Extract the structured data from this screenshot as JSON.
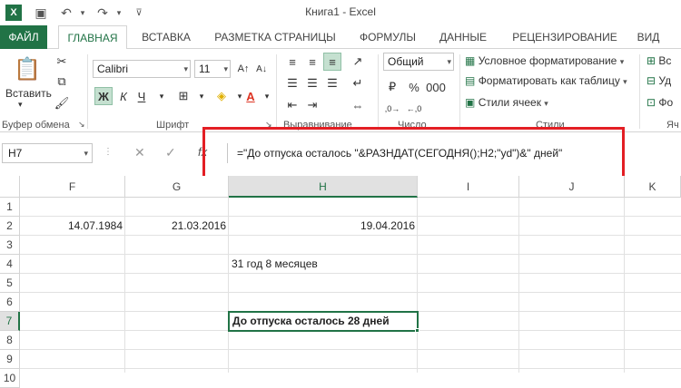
{
  "window": {
    "title": "Книга1 - Excel"
  },
  "quick_access": [
    "excel-logo-icon",
    "save-icon",
    "undo-icon",
    "redo-icon",
    "customize-icon"
  ],
  "tabs": [
    "ФАЙЛ",
    "ГЛАВНАЯ",
    "ВСТАВКА",
    "РАЗМЕТКА СТРАНИЦЫ",
    "ФОРМУЛЫ",
    "ДАННЫЕ",
    "РЕЦЕНЗИРОВАНИЕ",
    "ВИД"
  ],
  "ribbon": {
    "paste_label": "Вставить",
    "clipboard_label": "Буфер обмена",
    "font_label": "Шрифт",
    "font_name": "Calibri",
    "font_size": "11",
    "bold": "Ж",
    "italic": "К",
    "underline": "Ч",
    "alignment_label": "Выравнивание",
    "number_label": "Число",
    "number_format": "Общий",
    "styles_label": "Стили",
    "conditional_format": "Условное форматирование",
    "format_table": "Форматировать как таблицу",
    "cell_styles": "Стили ячеек",
    "cells_label": "Яч",
    "insert_partial": "Вс",
    "delete_partial": "Уд",
    "format_partial": "Фо"
  },
  "formula_bar": {
    "name_box": "H7",
    "formula": "=\"До отпуска осталось \"&РАЗНДАТ(СЕГОДНЯ();H2;\"yd\")&\" дней\""
  },
  "grid": {
    "columns": [
      "F",
      "G",
      "H",
      "I",
      "J",
      "K"
    ],
    "rows": [
      "1",
      "2",
      "3",
      "4",
      "5",
      "6",
      "7",
      "8",
      "9",
      "10"
    ],
    "cells": {
      "F2": "14.07.1984",
      "G2": "21.03.2016",
      "H2": "19.04.2016",
      "H4": "31 год 8 месяцев",
      "H7": "До отпуска осталось 28 дней"
    },
    "active_cell": "H7",
    "accent": "#217346",
    "highlight": "#e31e24"
  }
}
